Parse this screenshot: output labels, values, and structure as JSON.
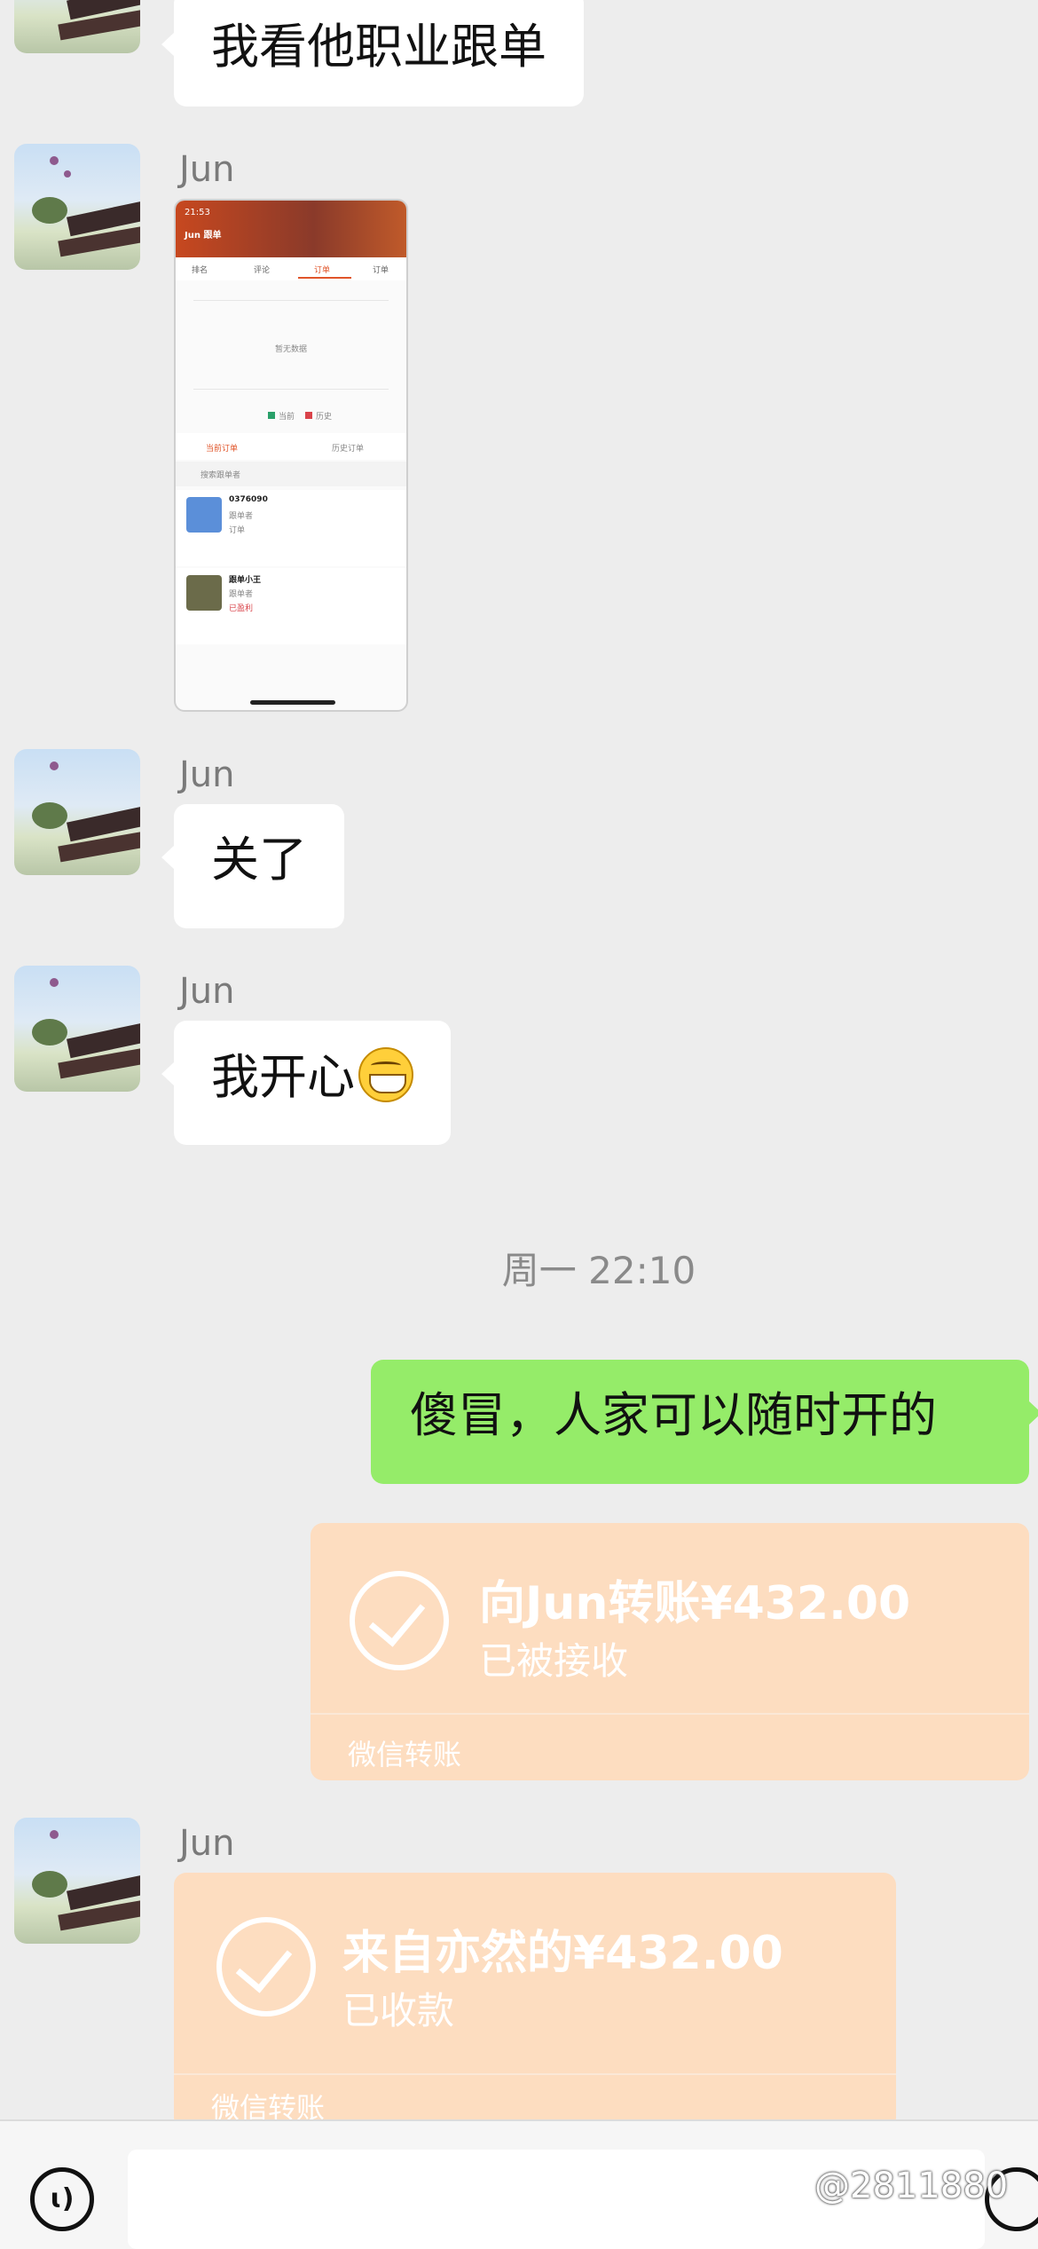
{
  "messages": {
    "m0_text": "我看他职业跟单",
    "m1_name": "Jun",
    "m2_name": "Jun",
    "m2_text": "关了",
    "m3_name": "Jun",
    "m3_text": "我开心",
    "m3_emoji": "grinning-face",
    "timestamp": "周一 22:10",
    "m4_text": "傻冒，人家可以随时开的",
    "m5": {
      "title": "向Jun转账¥432.00",
      "status": "已被接收",
      "footer": "微信转账"
    },
    "m6_name": "Jun",
    "m6": {
      "title": "来自亦然的¥432.00",
      "status": "已收款",
      "footer": "微信转账"
    }
  },
  "embedded_screenshot": {
    "header": "Jun 跟单",
    "tabs": [
      "排名",
      "评论",
      "订单",
      "订单"
    ],
    "empty": "暂无数据",
    "legend": [
      "当前",
      "历史"
    ],
    "sub_tabs": [
      "当前订单",
      "历史订单"
    ],
    "search": "搜索跟单者",
    "items": [
      {
        "title": "0376090",
        "lines": [
          "跟单者",
          "订单"
        ]
      },
      {
        "title": "跟单小王",
        "lines": [
          "跟单者",
          "已盈利"
        ]
      }
    ]
  },
  "inputbar": {
    "voice_icon": "voice-icon",
    "emoji_icon": "emoji-icon"
  },
  "watermark": "@2811880",
  "colors": {
    "background": "#ededed",
    "bubble_left": "#ffffff",
    "bubble_right": "#95ec69",
    "transfer": "#fdddc0"
  }
}
